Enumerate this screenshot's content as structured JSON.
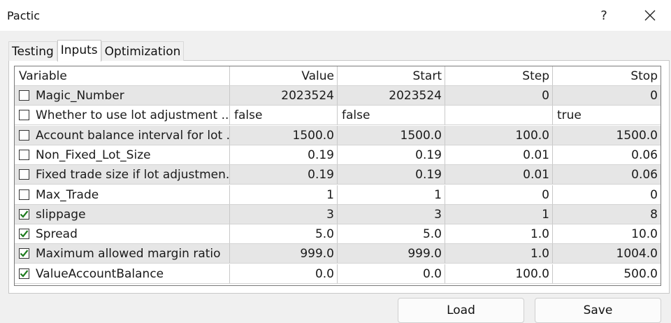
{
  "window": {
    "title": "Pactic",
    "help_label": "?"
  },
  "tabs": [
    "Testing",
    "Inputs",
    "Optimization"
  ],
  "active_tab": "Inputs",
  "columns": [
    "Variable",
    "Value",
    "Start",
    "Step",
    "Stop"
  ],
  "rows": [
    {
      "checked": false,
      "variable": "Magic_Number",
      "value": "2023524",
      "start": "2023524",
      "step": "0",
      "stop": "0"
    },
    {
      "checked": false,
      "variable": "Whether to use lot adjustment ...",
      "value": "false",
      "start": "false",
      "step": "",
      "stop": "true"
    },
    {
      "checked": false,
      "variable": "Account balance interval for lot ...",
      "value": "1500.0",
      "start": "1500.0",
      "step": "100.0",
      "stop": "1500.0"
    },
    {
      "checked": false,
      "variable": "Non_Fixed_Lot_Size",
      "value": "0.19",
      "start": "0.19",
      "step": "0.01",
      "stop": "0.06"
    },
    {
      "checked": false,
      "variable": "Fixed trade size if lot adjustmen...",
      "value": "0.19",
      "start": "0.19",
      "step": "0.01",
      "stop": "0.06"
    },
    {
      "checked": false,
      "variable": "Max_Trade",
      "value": "1",
      "start": "1",
      "step": "0",
      "stop": "0"
    },
    {
      "checked": true,
      "variable": "slippage",
      "value": "3",
      "start": "3",
      "step": "1",
      "stop": "8"
    },
    {
      "checked": true,
      "variable": "Spread",
      "value": "5.0",
      "start": "5.0",
      "step": "1.0",
      "stop": "10.0"
    },
    {
      "checked": true,
      "variable": "Maximum allowed margin ratio",
      "value": "999.0",
      "start": "999.0",
      "step": "1.0",
      "stop": "1004.0"
    },
    {
      "checked": true,
      "variable": "ValueAccountBalance",
      "value": "0.0",
      "start": "0.0",
      "step": "100.0",
      "stop": "500.0"
    }
  ],
  "buttons": {
    "load": "Load",
    "save": "Save"
  },
  "colors": {
    "check_mark": "#1e7b1e",
    "row_alt": "#e6e6e6",
    "window_bg": "#f0f0f0"
  }
}
